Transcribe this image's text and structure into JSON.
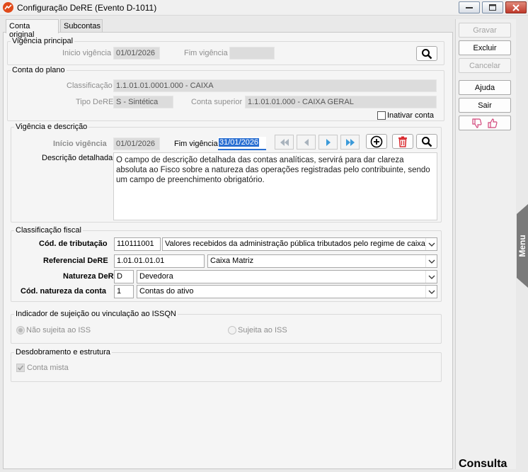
{
  "window": {
    "title": "Configuração DeRE (Evento D-1011)"
  },
  "tabs": [
    "Conta original",
    "Subcontas"
  ],
  "vigencia_principal": {
    "title": "Vigência principal",
    "inicio_label": "Inicio vigência",
    "inicio_value": "01/01/2026",
    "fim_label": "Fim vigência",
    "fim_value": ""
  },
  "conta_plano": {
    "title": "Conta do plano",
    "classificacao_label": "Classificação",
    "classificacao_value": "1.1.01.01.0001.000 - CAIXA",
    "tipo_label": "Tipo DeRE",
    "tipo_value": "S - Sintética",
    "superior_label": "Conta superior",
    "superior_value": "1.1.01.01.000 - CAIXA GERAL",
    "inativar_label": "Inativar conta"
  },
  "vigencia_descricao": {
    "title": "Vigência e descrição",
    "inicio_label": "Início vigência",
    "inicio_value": "01/01/2026",
    "fim_label": "Fim vigência",
    "fim_value": "31/01/2026",
    "descricao_label": "Descrição detalhada",
    "descricao_value": "O campo de descrição detalhada das contas analíticas, servirá para dar clareza absoluta ao Fisco sobre a natureza das operações registradas pelo contribuinte, sendo um campo de preenchimento obrigatório."
  },
  "classificacao_fiscal": {
    "title": "Classificação fiscal",
    "tributacao_label": "Cód. de tributação",
    "tributacao_code": "110111001",
    "tributacao_desc": "Valores recebidos da administração pública tributados pelo regime de caixa",
    "referencial_label": "Referencial DeRE",
    "referencial_code": "1.01.01.01.01",
    "referencial_desc": "Caixa Matriz",
    "natureza_label": "Natureza DeRE",
    "natureza_code": "D",
    "natureza_desc": "Devedora",
    "cod_natureza_label": "Cód. natureza da conta",
    "cod_natureza_code": "1",
    "cod_natureza_desc": "Contas do ativo"
  },
  "issqn": {
    "title": "Indicador de sujeição ou vinculação ao ISSQN",
    "option1": "Não sujeita ao ISS",
    "option2": "Sujeita ao ISS"
  },
  "desdobramento": {
    "title": "Desdobramento e estrutura",
    "conta_mista": "Conta mista"
  },
  "side": {
    "gravar": "Gravar",
    "excluir": "Excluir",
    "cancelar": "Cancelar",
    "ajuda": "Ajuda",
    "sair": "Sair",
    "menu": "Menu",
    "mode": "Consulta"
  },
  "colors": {
    "accent": "#2a6fd2",
    "delete": "#d9262b",
    "feedback": "#d2457a",
    "menu_tab": "#7a7a7a"
  },
  "icons": [
    "app-icon",
    "search-icon",
    "first-icon",
    "prev-icon",
    "next-icon",
    "last-icon",
    "add-icon",
    "trash-icon",
    "thumbs-down-icon",
    "thumbs-up-icon",
    "chevron-down-icon"
  ]
}
